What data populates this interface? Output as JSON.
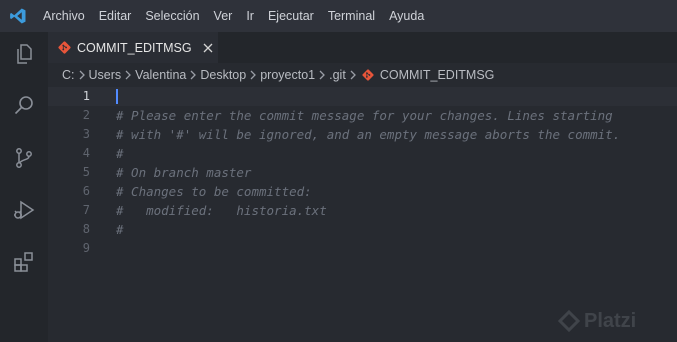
{
  "menubar": {
    "app_icon": "vscode-logo-icon",
    "items": [
      "Archivo",
      "Editar",
      "Selección",
      "Ver",
      "Ir",
      "Ejecutar",
      "Terminal",
      "Ayuda"
    ]
  },
  "activity_bar": {
    "icons": [
      "explorer-icon",
      "search-icon",
      "source-control-icon",
      "run-debug-icon",
      "extensions-icon"
    ]
  },
  "tab": {
    "label": "COMMIT_EDITMSG",
    "icon": "git-icon",
    "close_icon": "close-icon"
  },
  "breadcrumb": {
    "items": [
      "C:",
      "Users",
      "Valentina",
      "Desktop",
      "proyecto1",
      ".git",
      "COMMIT_EDITMSG"
    ]
  },
  "editor": {
    "current_line": 1,
    "lines": [
      {
        "number": "1",
        "text": ""
      },
      {
        "number": "2",
        "text": "# Please enter the commit message for your changes. Lines starting"
      },
      {
        "number": "3",
        "text": "# with '#' will be ignored, and an empty message aborts the commit."
      },
      {
        "number": "4",
        "text": "#"
      },
      {
        "number": "5",
        "text": "# On branch master"
      },
      {
        "number": "6",
        "text": "# Changes to be committed:"
      },
      {
        "number": "7",
        "text": "#   modified:   historia.txt"
      },
      {
        "number": "8",
        "text": "#"
      },
      {
        "number": "9",
        "text": ""
      }
    ]
  },
  "watermark": {
    "text": "Platzi"
  },
  "colors": {
    "accent": "#528bff",
    "git": "#e8553a",
    "vscode_blue": "#3c9bdc"
  }
}
